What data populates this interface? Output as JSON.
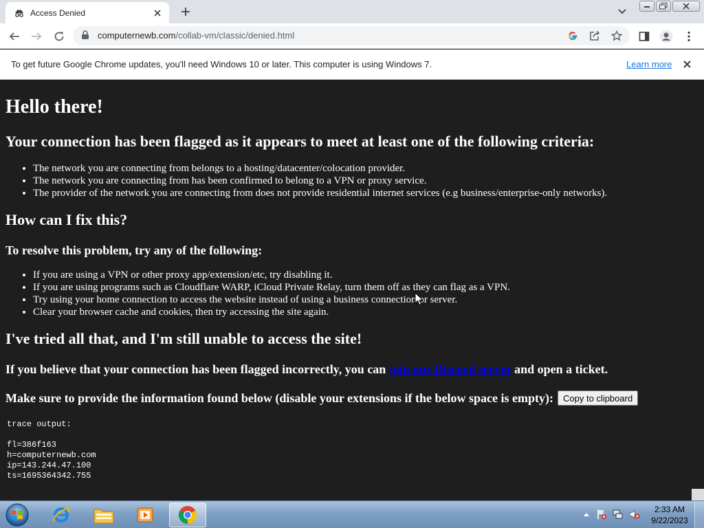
{
  "browser": {
    "tab": {
      "title": "Access Denied",
      "favicon": "incognito-spy-icon"
    },
    "address": {
      "host": "computernewb.com",
      "path": "/collab-vm/classic/denied.html"
    },
    "infobar": {
      "message": "To get future Google Chrome updates, you'll need Windows 10 or later. This computer is using Windows 7.",
      "link": "Learn more"
    }
  },
  "page": {
    "h1": "Hello there!",
    "criteria_heading": "Your connection has been flagged as it appears to meet at least one of the following criteria:",
    "criteria": [
      "The network you are connecting from belongs to a hosting/datacenter/colocation provider.",
      "The network you are connecting from has been confirmed to belong to a VPN or proxy service.",
      "The provider of the network you are connecting from does not provide residential internet services (e.g business/enterprise-only networks)."
    ],
    "fix_heading": "How can I fix this?",
    "resolve_heading": "To resolve this problem, try any of the following:",
    "fixes": [
      "If you are using a VPN or other proxy app/extension/etc, try disabling it.",
      "If you are using programs such as Cloudflare WARP, iCloud Private Relay, turn them off as they can flag as a VPN.",
      "Try using your home connection to access the website instead of using a business connection or server.",
      "Clear your browser cache and cookies, then try accessing the site again."
    ],
    "still_heading": "I've tried all that, and I'm still unable to access the site!",
    "ticket_before": "If you believe that your connection has been flagged incorrectly, you can ",
    "ticket_link": "join our Discord server",
    "ticket_after": " and open a ticket.",
    "provide_text": "Make sure to provide the information found below (disable your extensions if the below space is empty):",
    "copy_button": "Copy to clipboard",
    "trace_lines": [
      "trace output:",
      "",
      "fl=386f163",
      "h=computernewb.com",
      "ip=143.244.47.100",
      "ts=1695364342.755"
    ]
  },
  "taskbar": {
    "apps": [
      "internet-explorer-icon",
      "file-explorer-icon",
      "media-player-icon",
      "chrome-icon"
    ],
    "clock": {
      "time": "2:33 AM",
      "date": "9/22/2023"
    }
  }
}
